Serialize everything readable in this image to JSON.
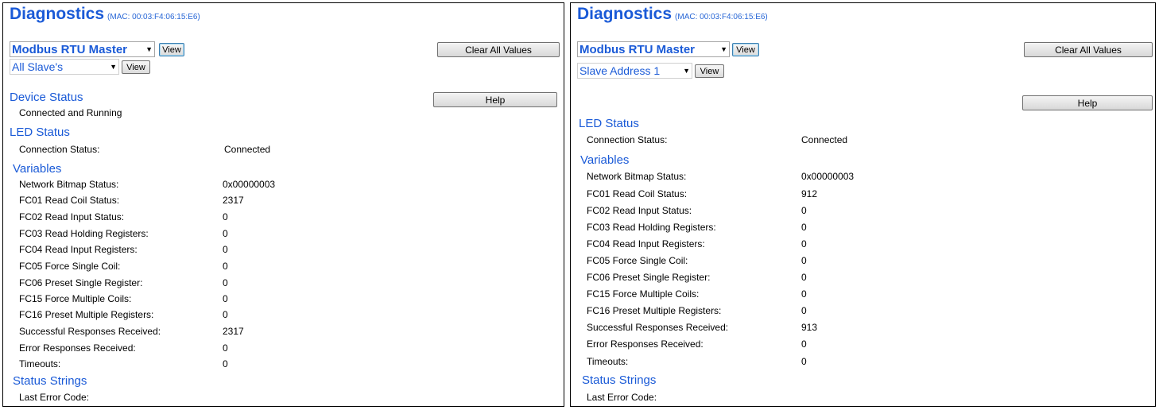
{
  "panels": [
    {
      "title": "Diagnostics",
      "mac": "(MAC: 00:03:F4:06:15:E6)",
      "device_select": "Modbus RTU Master",
      "view_label": "View",
      "slave_select": "All Slave's",
      "view2_label": "View",
      "clear_label": "Clear All Values",
      "help_label": "Help",
      "device_status": {
        "heading": "Device Status",
        "text": "Connected and Running"
      },
      "led_status": {
        "heading": "LED Status",
        "label": "Connection Status:",
        "value": "Connected"
      },
      "variables_heading": "Variables",
      "variables": [
        {
          "label": "Network Bitmap Status:",
          "value": "0x00000003"
        },
        {
          "label": "FC01 Read Coil Status:",
          "value": "2317"
        },
        {
          "label": "FC02 Read Input Status:",
          "value": "0"
        },
        {
          "label": "FC03 Read Holding Registers:",
          "value": "0"
        },
        {
          "label": "FC04 Read Input Registers:",
          "value": "0"
        },
        {
          "label": "FC05 Force Single Coil:",
          "value": "0"
        },
        {
          "label": "FC06 Preset Single Register:",
          "value": "0"
        },
        {
          "label": "FC15 Force Multiple Coils:",
          "value": "0"
        },
        {
          "label": "FC16 Preset Multiple Registers:",
          "value": "0"
        },
        {
          "label": "Successful Responses Received:",
          "value": "2317"
        },
        {
          "label": "Error Responses Received:",
          "value": "0"
        },
        {
          "label": "Timeouts:",
          "value": "0"
        }
      ],
      "status_strings": {
        "heading": "Status Strings",
        "label": "Last Error Code:"
      }
    },
    {
      "title": "Diagnostics",
      "mac": "(MAC: 00:03:F4:06:15:E6)",
      "device_select": "Modbus RTU Master",
      "view_label": "View",
      "slave_select": "Slave Address 1",
      "view2_label": "View",
      "clear_label": "Clear All Values",
      "help_label": "Help",
      "led_status": {
        "heading": "LED Status",
        "label": "Connection Status:",
        "value": "Connected"
      },
      "variables_heading": "Variables",
      "variables": [
        {
          "label": "Network Bitmap Status:",
          "value": "0x00000003"
        },
        {
          "label": "FC01 Read Coil Status:",
          "value": "912"
        },
        {
          "label": "FC02 Read Input Status:",
          "value": "0"
        },
        {
          "label": "FC03 Read Holding Registers:",
          "value": "0"
        },
        {
          "label": "FC04 Read Input Registers:",
          "value": "0"
        },
        {
          "label": "FC05 Force Single Coil:",
          "value": "0"
        },
        {
          "label": "FC06 Preset Single Register:",
          "value": "0"
        },
        {
          "label": "FC15 Force Multiple Coils:",
          "value": "0"
        },
        {
          "label": "FC16 Preset Multiple Registers:",
          "value": "0"
        },
        {
          "label": "Successful Responses Received:",
          "value": "913"
        },
        {
          "label": "Error Responses Received:",
          "value": "0"
        },
        {
          "label": "Timeouts:",
          "value": "0"
        }
      ],
      "status_strings": {
        "heading": "Status Strings",
        "label": "Last Error Code:"
      }
    }
  ]
}
